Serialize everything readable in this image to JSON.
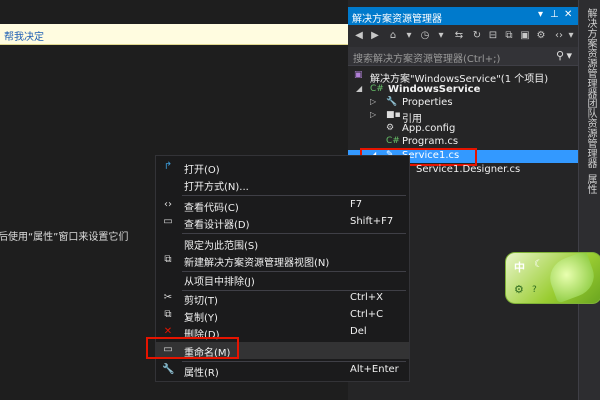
{
  "infobar": {
    "text": "帮我决定"
  },
  "editor": {
    "partial_text": "然后使用“属性”窗口来设置它们"
  },
  "solution_explorer": {
    "title": "解决方案资源管理器",
    "pin_icon": "pin-icon",
    "search_placeholder": "搜索解决方案资源管理器(Ctrl+;)",
    "tree": {
      "solution": "解决方案\"WindowsService\"(1 个项目)",
      "project": "WindowsService",
      "properties": "Properties",
      "references": "引用",
      "app_config": "App.config",
      "program_cs": "Program.cs",
      "service1_cs": "Service1.cs",
      "service1_designer": "Service1.Designer.cs"
    }
  },
  "vertical_tabs": [
    "解决方案资源管理器",
    "团队资源管理器",
    "属性"
  ],
  "context_menu": {
    "items": [
      {
        "label": "打开(O)",
        "shortcut": "",
        "icon": "open-icon"
      },
      {
        "label": "打开方式(N)...",
        "shortcut": "",
        "icon": ""
      },
      {
        "label": "查看代码(C)",
        "shortcut": "F7",
        "icon": "code-icon"
      },
      {
        "label": "查看设计器(D)",
        "shortcut": "Shift+F7",
        "icon": "designer-icon"
      },
      {
        "label": "限定为此范围(S)",
        "shortcut": "",
        "icon": ""
      },
      {
        "label": "新建解决方案资源管理器视图(N)",
        "shortcut": "",
        "icon": "new-view-icon"
      },
      {
        "label": "从项目中排除(J)",
        "shortcut": "",
        "icon": ""
      },
      {
        "label": "剪切(T)",
        "shortcut": "Ctrl+X",
        "icon": "scissors-icon"
      },
      {
        "label": "复制(Y)",
        "shortcut": "Ctrl+C",
        "icon": "copy-icon"
      },
      {
        "label": "删除(D)",
        "shortcut": "Del",
        "icon": "delete-icon"
      },
      {
        "label": "重命名(M)",
        "shortcut": "",
        "icon": "rename-icon"
      },
      {
        "label": "属性(R)",
        "shortcut": "Alt+Enter",
        "icon": "wrench-icon"
      }
    ]
  },
  "widget": {
    "lang": "中"
  },
  "colors": {
    "accent": "#007acc",
    "selection": "#3399ff",
    "highlight_box": "#e51400"
  }
}
